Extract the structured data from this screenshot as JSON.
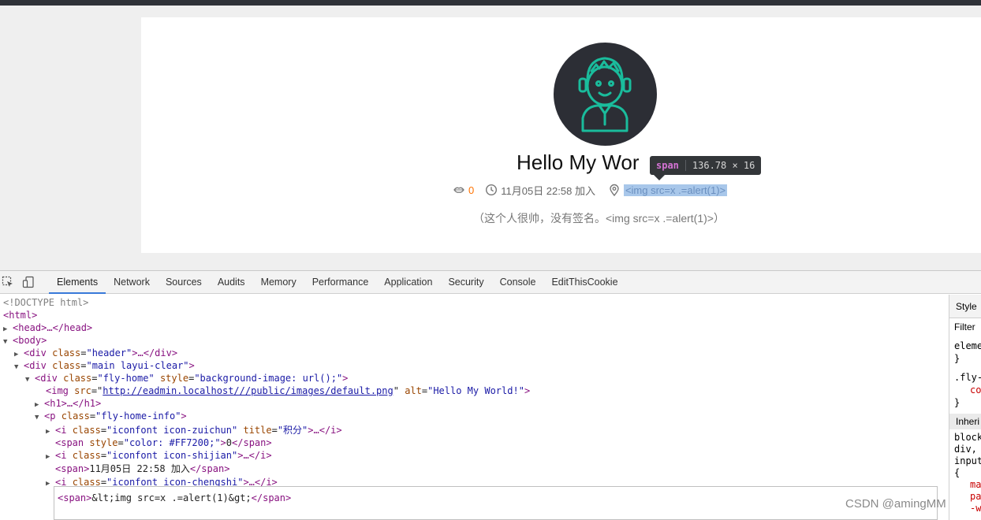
{
  "page": {
    "home_name": "Hello My Wor",
    "score": "0",
    "join_time": "11月05日 22:58 加入",
    "location": "<img src=x .=alert(1)>",
    "sign": "（这个人很帅，没有签名。<img src=x .=alert(1)>）",
    "tooltip_tag": "span",
    "tooltip_dims": "136.78 × 16"
  },
  "devtools": {
    "tabs": [
      "Elements",
      "Network",
      "Sources",
      "Audits",
      "Memory",
      "Performance",
      "Application",
      "Security",
      "Console",
      "EditThisCookie"
    ],
    "active_tab": "Elements",
    "dom": {
      "doctype": "<!DOCTYPE html>",
      "html": "<html>",
      "head": "<head>…</head>",
      "body": "<body>",
      "header_tag": "<div ",
      "header_attr": "class",
      "header_val": "\"header\"",
      "header_close": ">…</div>",
      "main_tag": "<div ",
      "main_attr": "class",
      "main_val": "\"main layui-clear\"",
      "main_close": ">",
      "flyhome_tag": "<div ",
      "flyhome_attr1": "class",
      "flyhome_val1": "\"fly-home\"",
      "flyhome_attr2": " style",
      "flyhome_val2": "\"background-image: url();\"",
      "flyhome_close": ">",
      "img_tag": "<img ",
      "img_attr1": "src",
      "img_src": "http://eadmin.localhost///public/images/default.png",
      "img_attr2": " alt",
      "img_alt": "\"Hello My World!\"",
      "img_close": ">",
      "h1": "<h1>…</h1>",
      "p_tag": "<p ",
      "p_attr": "class",
      "p_val": "\"fly-home-info\"",
      "p_close": ">",
      "i1_tag": "<i ",
      "i1_attr1": "class",
      "i1_val1": "\"iconfont icon-zuichun\"",
      "i1_attr2": " title",
      "i1_val2": "\"积分\"",
      "i1_close": ">…</i>",
      "span1_tag": "<span ",
      "span1_attr": "style",
      "span1_val": "\"color: #FF7200;\"",
      "span1_open_end": ">",
      "span1_text": "0",
      "span1_close": "</span>",
      "i2_tag": "<i ",
      "i2_attr": "class",
      "i2_val": "\"iconfont icon-shijian\"",
      "i2_close": ">…</i>",
      "span2_open": "<span>",
      "span2_text": "11月05日 22:58 加入",
      "span2_close": "</span>",
      "i3_tag": "<i ",
      "i3_attr": "class",
      "i3_val": "\"iconfont icon-chengshi\"",
      "i3_close": ">…</i>"
    },
    "edit_open": "<span>",
    "edit_text": "&lt;img src=x .=alert(1)&gt;",
    "edit_close": "</span>",
    "styles": {
      "tab": "Style",
      "filter": "Filter",
      "rule1": "eleme",
      "rule1_end": "}",
      "rule2": ".fly-",
      "rule2_prop": "co",
      "rule2_end": "}",
      "inherited": "Inheri",
      "inh1": "block",
      "inh2": "div,",
      "inh3": "input",
      "inh4": "{",
      "inh5": "ma",
      "inh6": "pa",
      "inh7": "-w"
    }
  },
  "watermark": "CSDN @amingMM",
  "colors": {
    "accent_orange": "#FF7200",
    "avatar_bg": "#2c2e35",
    "avatar_line": "#1abc9c",
    "selection": "#a8c7ea",
    "tab_active": "#3879d9"
  }
}
